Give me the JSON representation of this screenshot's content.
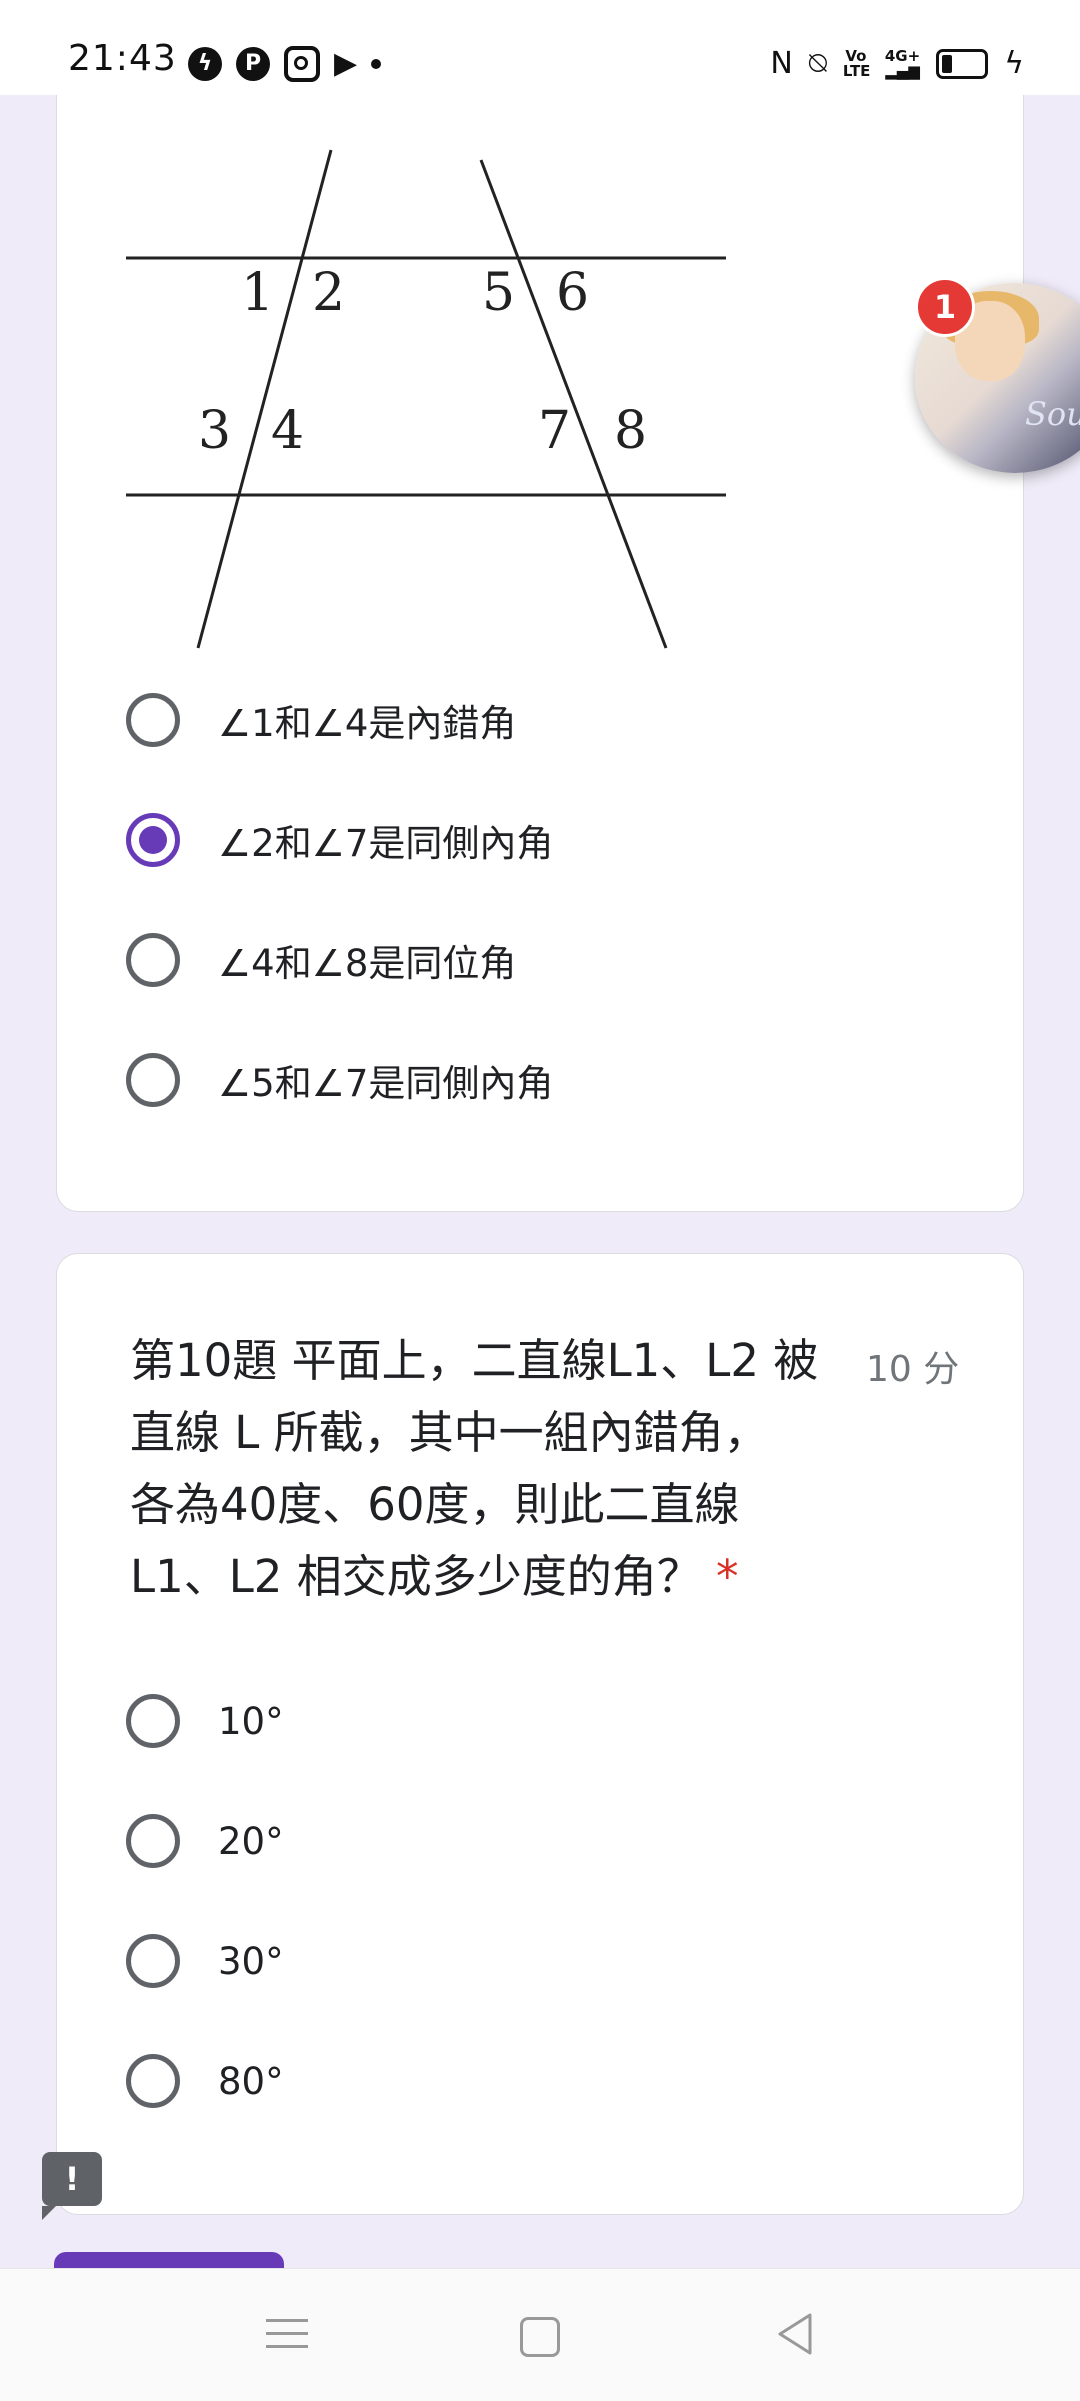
{
  "status_bar": {
    "time": "21:43",
    "app_icons": [
      "messenger-icon",
      "pinterest-icon",
      "instagram-icon",
      "play-icon",
      "dot-icon"
    ],
    "system_icons": [
      "nfc-icon",
      "vibrate-icon",
      "volte-icon",
      "4g-signal-icon",
      "battery-charging-icon"
    ],
    "volte_label": "Vo LTE",
    "network_label": "4G+"
  },
  "question9": {
    "figure_labels": [
      "1",
      "2",
      "3",
      "4",
      "5",
      "6",
      "7",
      "8"
    ],
    "options": [
      {
        "label": "∠1和∠4是內錯角",
        "selected": false
      },
      {
        "label": "∠2和∠7是同側內角",
        "selected": true
      },
      {
        "label": "∠4和∠8是同位角",
        "selected": false
      },
      {
        "label": "∠5和∠7是同側內角",
        "selected": false
      }
    ]
  },
  "question10": {
    "title_lines": [
      "第10題 平面上，二直線L1、L2 被",
      "直線 L 所截，其中一組內錯角，",
      "各為40度、60度，則此二直線",
      "L1、L2 相交成多少度的角？"
    ],
    "required_mark": "*",
    "points": "10 分",
    "options": [
      {
        "label": "10°",
        "selected": false
      },
      {
        "label": "20°",
        "selected": false
      },
      {
        "label": "30°",
        "selected": false
      },
      {
        "label": "80°",
        "selected": false
      }
    ]
  },
  "chat_bubble": {
    "badge_count": "1",
    "image_text": "Sou"
  },
  "feedback": {
    "icon_glyph": "!"
  },
  "colors": {
    "accent": "#673ab7",
    "background": "#efebf8",
    "required": "#d93025",
    "badge": "#e53935"
  }
}
